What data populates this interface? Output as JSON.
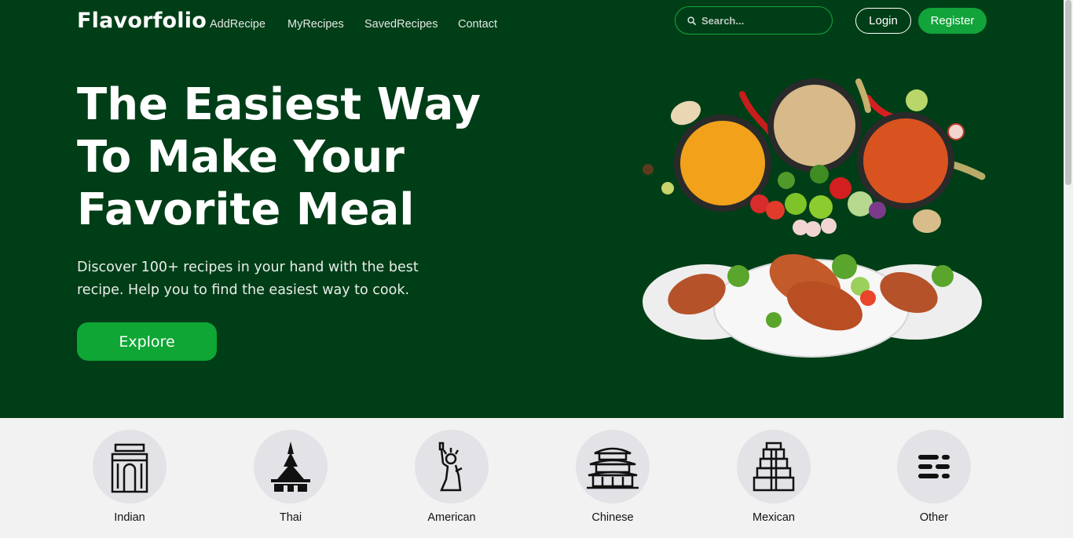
{
  "nav": {
    "brand": "Flavorfolio",
    "links": [
      "AddRecipe",
      "MyRecipes",
      "SavedRecipes",
      "Contact"
    ],
    "search_placeholder": "Search...",
    "login": "Login",
    "register": "Register"
  },
  "hero": {
    "headline": "The Easiest Way To Make Your Favorite Meal",
    "subtitle": "Discover 100+ recipes in your hand with the best recipe. Help you to find the easiest way to cook.",
    "cta": "Explore"
  },
  "categories": [
    {
      "label": "Indian",
      "icon": "india-gate-icon"
    },
    {
      "label": "Thai",
      "icon": "thai-temple-icon"
    },
    {
      "label": "American",
      "icon": "statue-of-liberty-icon"
    },
    {
      "label": "Chinese",
      "icon": "pagoda-icon"
    },
    {
      "label": "Mexican",
      "icon": "mayan-pyramid-icon"
    },
    {
      "label": "Other",
      "icon": "menu-lines-icon"
    }
  ],
  "colors": {
    "hero_bg": "#003e17",
    "accent": "#12a43a",
    "section_bg": "#f2f2f2"
  }
}
